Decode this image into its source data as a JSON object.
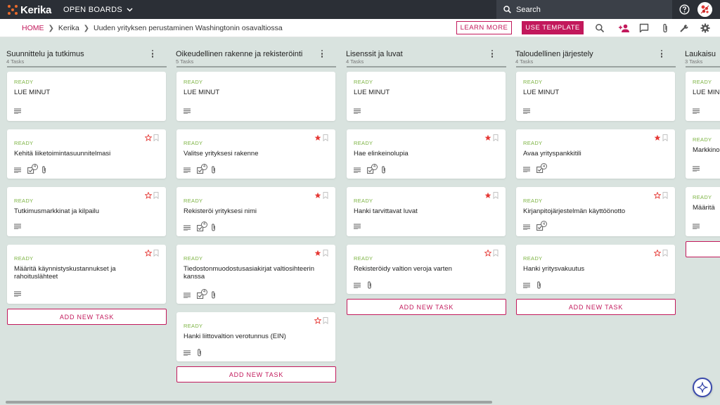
{
  "app": {
    "logo_text": "Kerika",
    "boards_menu_label": "OPEN BOARDS"
  },
  "search": {
    "placeholder": "Search"
  },
  "breadcrumb": {
    "home": "HOME",
    "account": "Kerika",
    "board": "Uuden yrityksen perustaminen Washingtonin osavaltiossa"
  },
  "toolbar": {
    "learn_more": "LEARN MORE",
    "use_template": "USE TEMPLATE"
  },
  "colors": {
    "accent": "#c2185b",
    "ready": "#7cb342",
    "star": "#e53935",
    "topbar": "#2b2f36",
    "board_bg": "#d9e3df"
  },
  "add_task_label": "ADD NEW TASK",
  "columns": [
    {
      "title": "Suunnittelu ja tutkimus",
      "count": "4 Tasks",
      "cards": [
        {
          "status": "READY",
          "title": "LUE MINUT",
          "icons": [
            "description"
          ],
          "flag": "none"
        },
        {
          "status": "READY",
          "title": "Kehitä liiketoimintasuunnitelmasi",
          "icons": [
            "description",
            "checklist",
            "attachment"
          ],
          "checklist_count": "4",
          "flag": "outline"
        },
        {
          "status": "READY",
          "title": "Tutkimusmarkkinat ja kilpailu",
          "icons": [
            "description"
          ],
          "flag": "outline"
        },
        {
          "status": "READY",
          "title": "Määritä käynnistyskustannukset ja rahoituslähteet",
          "icons": [
            "description"
          ],
          "flag": "outline"
        }
      ]
    },
    {
      "title": "Oikeudellinen rakenne ja rekisteröinti",
      "count": "5 Tasks",
      "cards": [
        {
          "status": "READY",
          "title": "LUE MINUT",
          "icons": [
            "description"
          ],
          "flag": "none"
        },
        {
          "status": "READY",
          "title": "Valitse yrityksesi rakenne",
          "icons": [
            "description",
            "checklist",
            "attachment"
          ],
          "checklist_count": "4",
          "flag": "filled"
        },
        {
          "status": "READY",
          "title": "Rekisteröi yrityksesi nimi",
          "icons": [
            "description",
            "checklist",
            "attachment"
          ],
          "checklist_count": "4",
          "flag": "filled"
        },
        {
          "status": "READY",
          "title": "Tiedostonmuodostusasiakirjat valtiosihteerin kanssa",
          "icons": [
            "description",
            "checklist",
            "attachment"
          ],
          "checklist_count": "4",
          "flag": "filled"
        },
        {
          "status": "READY",
          "title": "Hanki liittovaltion verotunnus (EIN)",
          "icons": [
            "description",
            "attachment"
          ],
          "flag": "outline"
        }
      ]
    },
    {
      "title": "Lisenssit ja luvat",
      "count": "4 Tasks",
      "cards": [
        {
          "status": "READY",
          "title": "LUE MINUT",
          "icons": [
            "description"
          ],
          "flag": "none"
        },
        {
          "status": "READY",
          "title": "Hae elinkeinolupia",
          "icons": [
            "description",
            "checklist",
            "attachment"
          ],
          "checklist_count": "4",
          "flag": "filled"
        },
        {
          "status": "READY",
          "title": "Hanki tarvittavat luvat",
          "icons": [
            "description"
          ],
          "flag": "filled"
        },
        {
          "status": "READY",
          "title": "Rekisteröidy valtion veroja varten",
          "icons": [
            "description",
            "attachment"
          ],
          "flag": "outline"
        }
      ]
    },
    {
      "title": "Taloudellinen järjestely",
      "count": "4 Tasks",
      "cards": [
        {
          "status": "READY",
          "title": "LUE MINUT",
          "icons": [
            "description"
          ],
          "flag": "none"
        },
        {
          "status": "READY",
          "title": "Avaa yrityspankkitili",
          "icons": [
            "description",
            "checklist"
          ],
          "checklist_count": "4",
          "flag": "filled"
        },
        {
          "status": "READY",
          "title": "Kirjanpitojärjestelmän käyttöönotto",
          "icons": [
            "description",
            "checklist"
          ],
          "checklist_count": "4",
          "flag": "outline"
        },
        {
          "status": "READY",
          "title": "Hanki yritysvakuutus",
          "icons": [
            "description",
            "attachment"
          ],
          "flag": "outline"
        }
      ]
    },
    {
      "title": "Laukaisu",
      "count": "3 Tasks",
      "cards": [
        {
          "status": "READY",
          "title": "LUE MINUT",
          "icons": [
            "description"
          ],
          "flag": "none"
        },
        {
          "status": "READY",
          "title": "Markkinointi",
          "icons": [
            "description"
          ],
          "flag": "none"
        },
        {
          "status": "READY",
          "title": "Määritä",
          "icons": [
            "description"
          ],
          "flag": "none"
        }
      ]
    }
  ]
}
